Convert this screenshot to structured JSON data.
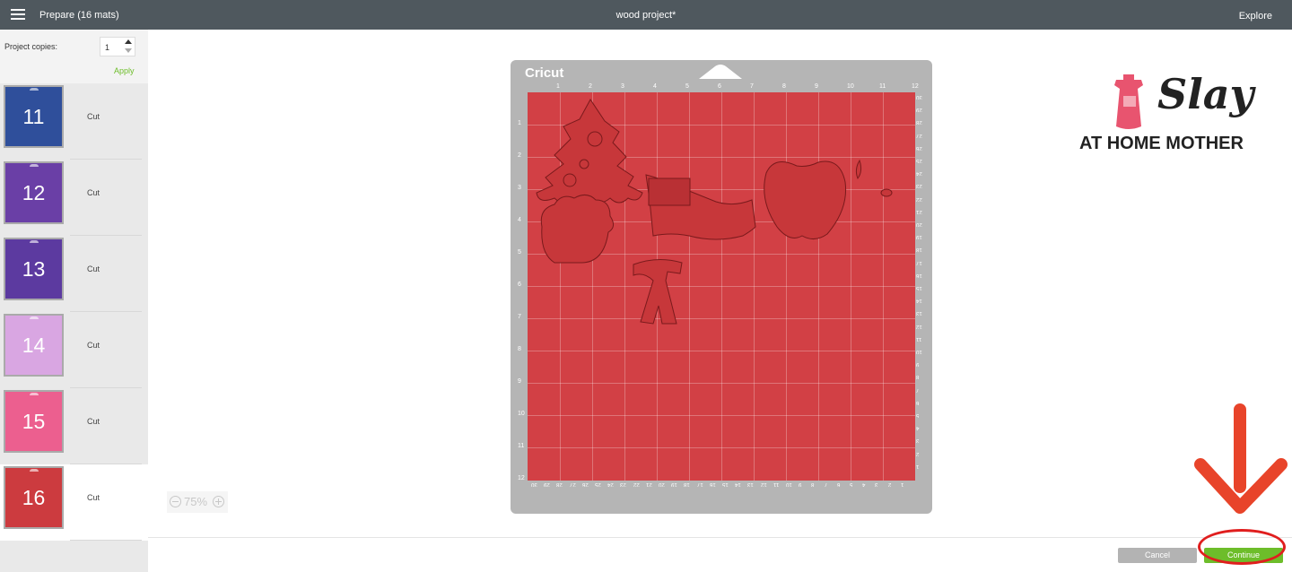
{
  "topbar": {
    "menu_icon": "hamburger-menu-icon",
    "title": "Prepare (16 mats)",
    "project_name": "wood project*",
    "explore_label": "Explore"
  },
  "sidebar": {
    "copies_label": "Project copies:",
    "copies_value": "1",
    "apply_label": "Apply",
    "mats": [
      {
        "number": "11",
        "action": "Cut",
        "color": "#2f4f9b",
        "active": false
      },
      {
        "number": "12",
        "action": "Cut",
        "color": "#6a3fa6",
        "active": false
      },
      {
        "number": "13",
        "action": "Cut",
        "color": "#5c3aa0",
        "active": false
      },
      {
        "number": "14",
        "action": "Cut",
        "color": "#d9a6e2",
        "active": false
      },
      {
        "number": "15",
        "action": "Cut",
        "color": "#ec5f8f",
        "active": false
      },
      {
        "number": "16",
        "action": "Cut",
        "color": "#cc3b3f",
        "active": true
      }
    ]
  },
  "canvas": {
    "zoom": "75%",
    "brand_text": "Cricut",
    "mat_color": "#d24045",
    "top_ruler": [
      "1",
      "2",
      "3",
      "4",
      "5",
      "6",
      "7",
      "8",
      "9",
      "10",
      "11",
      "12"
    ],
    "left_ruler": [
      "1",
      "2",
      "3",
      "4",
      "5",
      "6",
      "7",
      "8",
      "9",
      "10",
      "11",
      "12"
    ],
    "right_ruler": [
      "30",
      "29",
      "28",
      "27",
      "26",
      "25",
      "24",
      "23",
      "22",
      "21",
      "20",
      "19",
      "18",
      "17",
      "16",
      "15",
      "14",
      "13",
      "12",
      "11",
      "10",
      "9",
      "8",
      "7",
      "6",
      "5",
      "4",
      "3",
      "2",
      "1"
    ],
    "bottom_ruler": [
      "30",
      "29",
      "28",
      "27",
      "26",
      "25",
      "24",
      "23",
      "22",
      "21",
      "20",
      "19",
      "18",
      "17",
      "16",
      "15",
      "14",
      "13",
      "12",
      "11",
      "10",
      "9",
      "8",
      "7",
      "6",
      "5",
      "4",
      "3",
      "2",
      "1"
    ]
  },
  "watermark": {
    "line1": "Slay",
    "line2": "AT HOME MOTHER",
    "icon": "apron-icon"
  },
  "footer": {
    "cancel_label": "Cancel",
    "continue_label": "Continue",
    "continue_color": "#6dbd2a"
  },
  "annotation": {
    "arrow_color": "#e8442a",
    "ring_color": "#e01e1e"
  }
}
